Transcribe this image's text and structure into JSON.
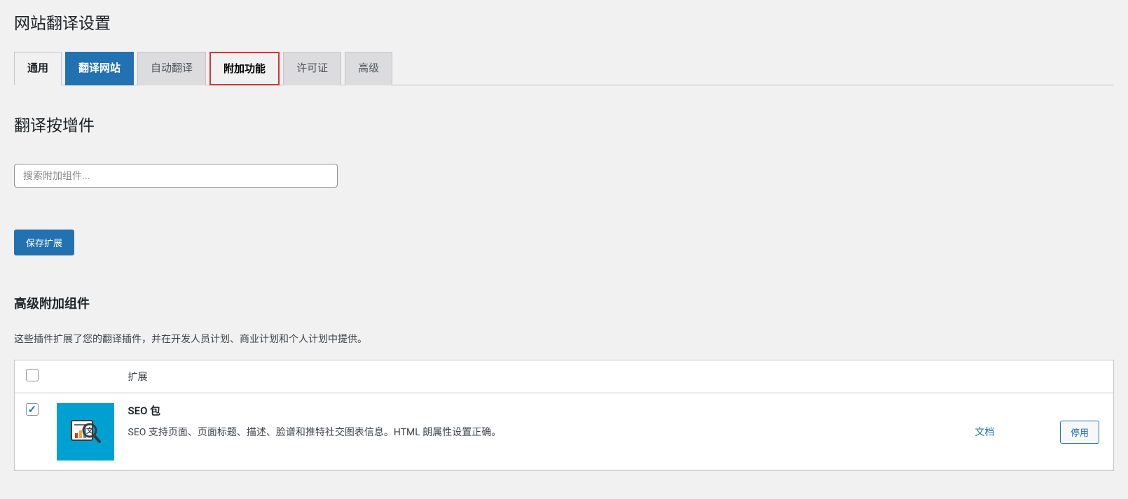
{
  "page_title": "网站翻译设置",
  "tabs": {
    "general": "通用",
    "translate_site": "翻译网站",
    "auto_translate": "自动翻译",
    "addons": "附加功能",
    "license": "许可证",
    "advanced": "高级"
  },
  "section_title": "翻译按增件",
  "search": {
    "placeholder": "搜索附加组件..."
  },
  "save_button": "保存扩展",
  "advanced_section": {
    "title": "高级附加组件",
    "description": "这些插件扩展了您的翻译插件，并在开发人员计划、商业计划和个人计划中提供。"
  },
  "table": {
    "header_extension": "扩展"
  },
  "addon": {
    "title": "SEO 包",
    "description": "SEO 支持页面、页面标题、描述、脸谱和推特社交图表信息。HTML 朗属性设置正确。",
    "doc_link": "文档",
    "disable_button": "停用"
  }
}
